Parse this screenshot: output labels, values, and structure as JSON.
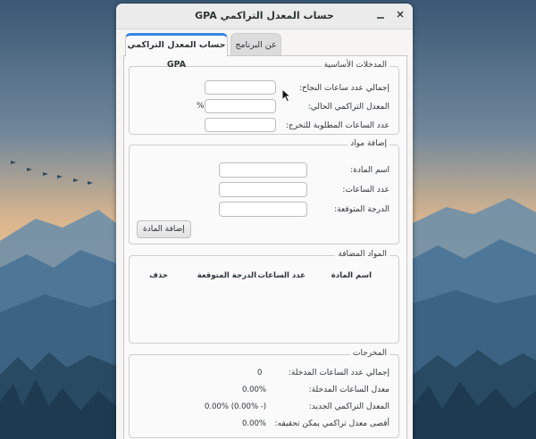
{
  "window": {
    "title": "حساب المعدل التراكمي GPA"
  },
  "tabs": [
    {
      "label": "حساب المعدل التراكمي GPA"
    },
    {
      "label": "عن البرنامج"
    }
  ],
  "basic_inputs": {
    "legend": "المدخلات الأساسية",
    "passed_hours_label": "إجمالي عدد ساعات النجاح:",
    "passed_hours_value": "",
    "current_gpa_label": "المعدل التراكمي الحالي:",
    "current_gpa_value": "",
    "percent_sign": "%",
    "required_hours_label": "عدد الساعات المطلوبة للتخرج:",
    "required_hours_value": ""
  },
  "add_course": {
    "legend": "إضافة مواد",
    "name_label": "اسم المادة:",
    "name_value": "",
    "hours_label": "عدد الساعات:",
    "hours_value": "",
    "grade_label": "الدرجة المتوقعة:",
    "grade_value": "",
    "add_button": "إضافة المادة"
  },
  "added_courses": {
    "legend": "المواد المضافة",
    "columns": [
      "اسم المادة",
      "عدد الساعات",
      "الدرجة المتوقعة",
      "حذف"
    ],
    "rows": []
  },
  "outputs": {
    "legend": "المخرجات",
    "total_hours_label": "إجمالي عدد الساعات المدخلة:",
    "total_hours_value": "0",
    "hours_rate_label": "معدل الساعات المدخلة:",
    "hours_rate_value": "0.00%",
    "new_gpa_label": "المعدل التراكمي الجديد:",
    "new_gpa_value": "0.00% (0.00% -)",
    "max_gpa_label": "أقصى معدل تراكمي يمكن تحقيقه:",
    "max_gpa_value": "0.00%"
  },
  "colors": {
    "accent": "#3584e4",
    "sky_top": "#3e5d78",
    "sky_glow": "#e8b98a",
    "mountains": "#3f6b8a"
  }
}
